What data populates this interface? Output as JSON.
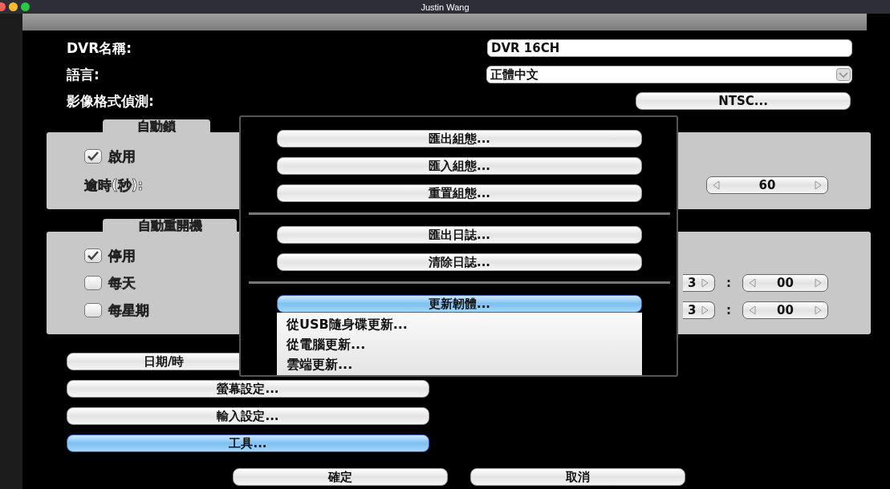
{
  "window": {
    "title": "Justin Wang"
  },
  "settings": [
    {
      "label": "DVR名稱:",
      "kind": "text",
      "value": "DVR 16CH"
    },
    {
      "label": "語言:",
      "kind": "dropdown",
      "value": "正體中文"
    },
    {
      "label": "影像格式偵測:",
      "kind": "button",
      "value": "NTSC..."
    }
  ],
  "auto_lock": {
    "title": "自動鎖",
    "enable": {
      "label": "啟用",
      "checked": true
    },
    "timeout_label": "逾時(秒):",
    "timeout_value": "60"
  },
  "auto_reboot": {
    "title": "自動重開機",
    "options": [
      {
        "label": "停用",
        "checked": true
      },
      {
        "label": "每天",
        "checked": false,
        "time": {
          "hour": "3",
          "separator": ":",
          "minute": "00"
        }
      },
      {
        "label": "每星期",
        "checked": false,
        "time": {
          "hour": "3",
          "separator": ":",
          "minute": "00"
        }
      }
    ]
  },
  "side_buttons": [
    {
      "label": "日期/時",
      "selected": false
    },
    {
      "label": "螢幕設定...",
      "selected": false
    },
    {
      "label": "輸入設定...",
      "selected": false
    },
    {
      "label": "工具...",
      "selected": true
    }
  ],
  "tools_menu": {
    "groups": [
      {
        "items": [
          {
            "label": "匯出組態...",
            "selected": false
          },
          {
            "label": "匯入組態...",
            "selected": false
          },
          {
            "label": "重置組態...",
            "selected": false
          }
        ]
      },
      {
        "items": [
          {
            "label": "匯出日誌...",
            "selected": false
          },
          {
            "label": "清除日誌...",
            "selected": false
          }
        ]
      },
      {
        "items": [
          {
            "label": "更新韌體...",
            "selected": true
          }
        ]
      }
    ],
    "submenu": [
      "從USB隨身碟更新...",
      "從電腦更新...",
      "雲端更新..."
    ]
  },
  "footer_buttons": [
    "確定",
    "取消"
  ]
}
